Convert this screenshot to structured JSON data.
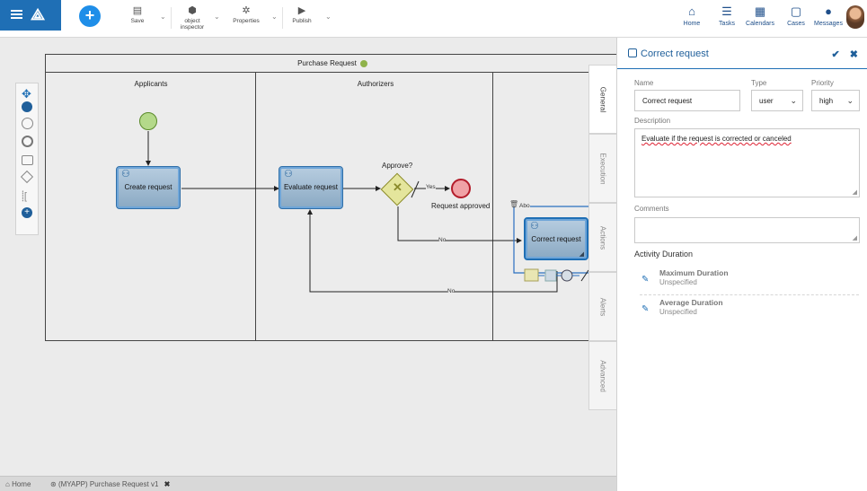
{
  "toolbar": {
    "save_label": "Save",
    "object_inspector_label": "object inspector",
    "properties_label": "Properties",
    "publish_label": "Publish"
  },
  "nav": {
    "home_label": "Home",
    "tasks_label": "Tasks",
    "calendars_label": "Calendars",
    "cases_label": "Cases",
    "messages_label": "Messages"
  },
  "diagram": {
    "pool_title": "Purchase Request",
    "lanes": [
      "Applicants",
      "Authorizers"
    ],
    "tasks": {
      "create": "Create request",
      "evaluate": "Evaluate request",
      "correct": "Correct request"
    },
    "gateway_label": "Approve?",
    "end_label": "Request approved",
    "flows": {
      "yes": "Yes",
      "no_1": "No",
      "no_2": "No",
      "abort": "Abo"
    }
  },
  "bottom_tabs": {
    "home": "Home",
    "document": "(MYAPP) Purchase Request v1"
  },
  "panel": {
    "title": "Correct request",
    "tabs": [
      "General",
      "Execution",
      "Actions",
      "Alerts",
      "Advanced"
    ],
    "name_label": "Name",
    "name_value": "Correct request",
    "type_label": "Type",
    "type_value": "user",
    "priority_label": "Priority",
    "priority_value": "high",
    "description_label": "Description",
    "description_value": "Evaluate if the request is corrected or canceled",
    "comments_label": "Comments",
    "comments_value": "",
    "activity_duration_label": "Activity Duration",
    "max_duration_title": "Maximum Duration",
    "max_duration_value": "Unspecified",
    "avg_duration_title": "Average Duration",
    "avg_duration_value": "Unspecified"
  },
  "colors": {
    "accent": "#1f6fb5",
    "task_fill": "#8aa9c3",
    "start_event": "#b4d98a",
    "end_event": "#b31c2a",
    "gateway": "#e4e59c"
  }
}
